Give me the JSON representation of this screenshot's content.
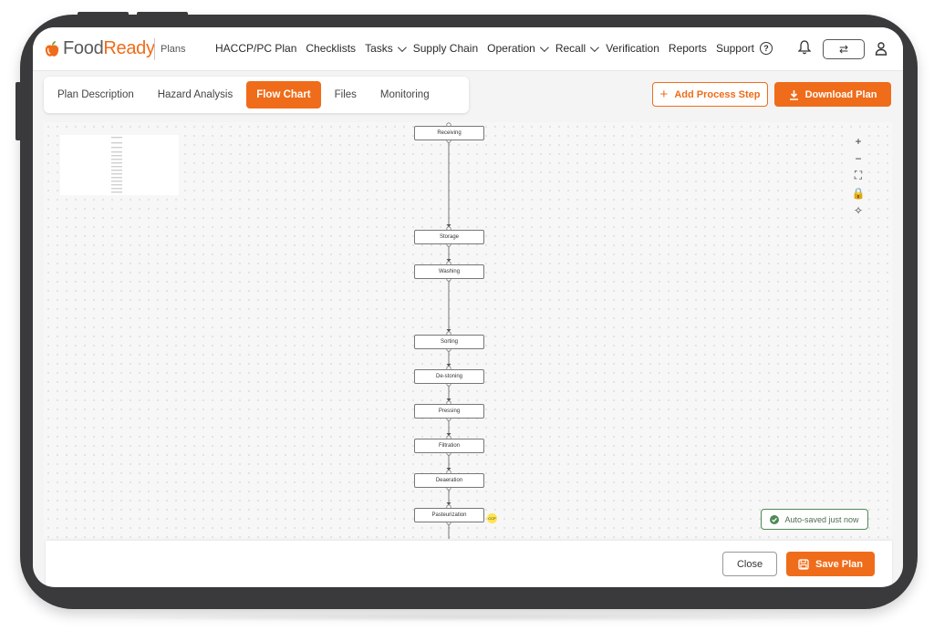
{
  "app": {
    "brand_prefix": "Food",
    "brand_suffix": "Ready",
    "section": "Plans"
  },
  "nav": {
    "items": [
      {
        "label": "HACCP/PC Plan",
        "dropdown": false
      },
      {
        "label": "Checklists",
        "dropdown": false
      },
      {
        "label": "Tasks",
        "dropdown": true
      },
      {
        "label": "Supply Chain",
        "dropdown": false
      },
      {
        "label": "Operation",
        "dropdown": true
      },
      {
        "label": "Recall",
        "dropdown": true
      },
      {
        "label": "Verification",
        "dropdown": false
      },
      {
        "label": "Reports",
        "dropdown": false
      },
      {
        "label": "Support",
        "dropdown": false
      }
    ],
    "switch_symbol": "⇄"
  },
  "tabs": [
    {
      "label": "Plan Description",
      "active": false
    },
    {
      "label": "Hazard Analysis",
      "active": false
    },
    {
      "label": "Flow Chart",
      "active": true
    },
    {
      "label": "Files",
      "active": false
    },
    {
      "label": "Monitoring",
      "active": false
    }
  ],
  "actions": {
    "add_step_label": "Add Process Step",
    "download_label": "Download Plan"
  },
  "zoom_controls": [
    "+",
    "−",
    "⛶",
    "🔒",
    "✧"
  ],
  "flow_steps": [
    {
      "label": "Receiving"
    },
    {
      "label": "Storage"
    },
    {
      "label": "Washing"
    },
    {
      "label": "Sorting"
    },
    {
      "label": "De-stoning"
    },
    {
      "label": "Pressing"
    },
    {
      "label": "Filtration"
    },
    {
      "label": "Deaeration"
    },
    {
      "label": "Pasteurization",
      "ccp": true
    }
  ],
  "ccp_label": "CCP",
  "status": {
    "autosave": "Auto-saved just now"
  },
  "footer": {
    "close_label": "Close",
    "save_label": "Save Plan"
  },
  "colors": {
    "accent": "#ef6c1a",
    "success": "#4f8a55",
    "ccp": "#ffe44d"
  }
}
